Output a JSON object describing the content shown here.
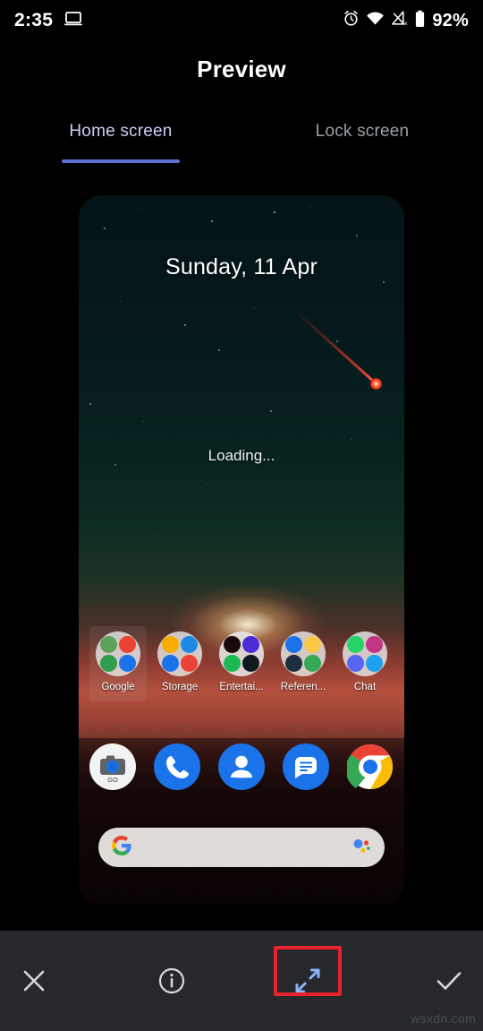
{
  "status_bar": {
    "time": "2:35",
    "battery_percent": "92%",
    "icons": [
      "laptop-cast-icon",
      "alarm-icon",
      "wifi-icon",
      "mobile-signal-off-icon",
      "battery-icon"
    ]
  },
  "header": {
    "title": "Preview"
  },
  "tabs": [
    {
      "label": "Home screen",
      "active": true
    },
    {
      "label": "Lock screen",
      "active": false
    }
  ],
  "preview": {
    "date": "Sunday, 11 Apr",
    "loading": "Loading...",
    "folders": [
      {
        "label": "Google",
        "selected": true,
        "colors": [
          "#5ea15a",
          "#ea4335",
          "#2f9e4f",
          "#1a73e8"
        ]
      },
      {
        "label": "Storage",
        "selected": false,
        "colors": [
          "#f9ab00",
          "#1e88e5",
          "#1a73e8",
          "#ea4335"
        ]
      },
      {
        "label": "Entertai...",
        "selected": false,
        "colors": [
          "#1a0b0b",
          "#4a2bd6",
          "#1db954",
          "#101820"
        ]
      },
      {
        "label": "Referen...",
        "selected": false,
        "colors": [
          "#1a73e8",
          "#f9c846",
          "#1f2e3d",
          "#34a853"
        ]
      },
      {
        "label": "Chat",
        "selected": false,
        "colors": [
          "#25d366",
          "#c13584",
          "#5865f2",
          "#1da1f2"
        ]
      }
    ],
    "dock": [
      {
        "name": "camera-go-icon",
        "label": "Camera Go"
      },
      {
        "name": "phone-icon",
        "label": "Phone"
      },
      {
        "name": "contacts-icon",
        "label": "Contacts"
      },
      {
        "name": "messages-icon",
        "label": "Messages"
      },
      {
        "name": "chrome-icon",
        "label": "Chrome"
      }
    ],
    "search_bar": {
      "google_logo": "google-g-icon",
      "assistant": "google-assistant-icon",
      "placeholder": ""
    }
  },
  "toolbar": {
    "close_label": "Close",
    "info_label": "Info",
    "resize_label": "Resize",
    "done_label": "Done",
    "highlighted": "resize-button"
  },
  "watermark": "wsxdn.com",
  "colors": {
    "accent_blue": "#5f6fd4",
    "tab_active_text": "#c7d0f5",
    "tab_inactive_text": "#9aa0a6",
    "toolbar_bg": "#26282b",
    "highlight_red": "#e8212b",
    "resize_icon_blue": "#8ab4f8"
  }
}
